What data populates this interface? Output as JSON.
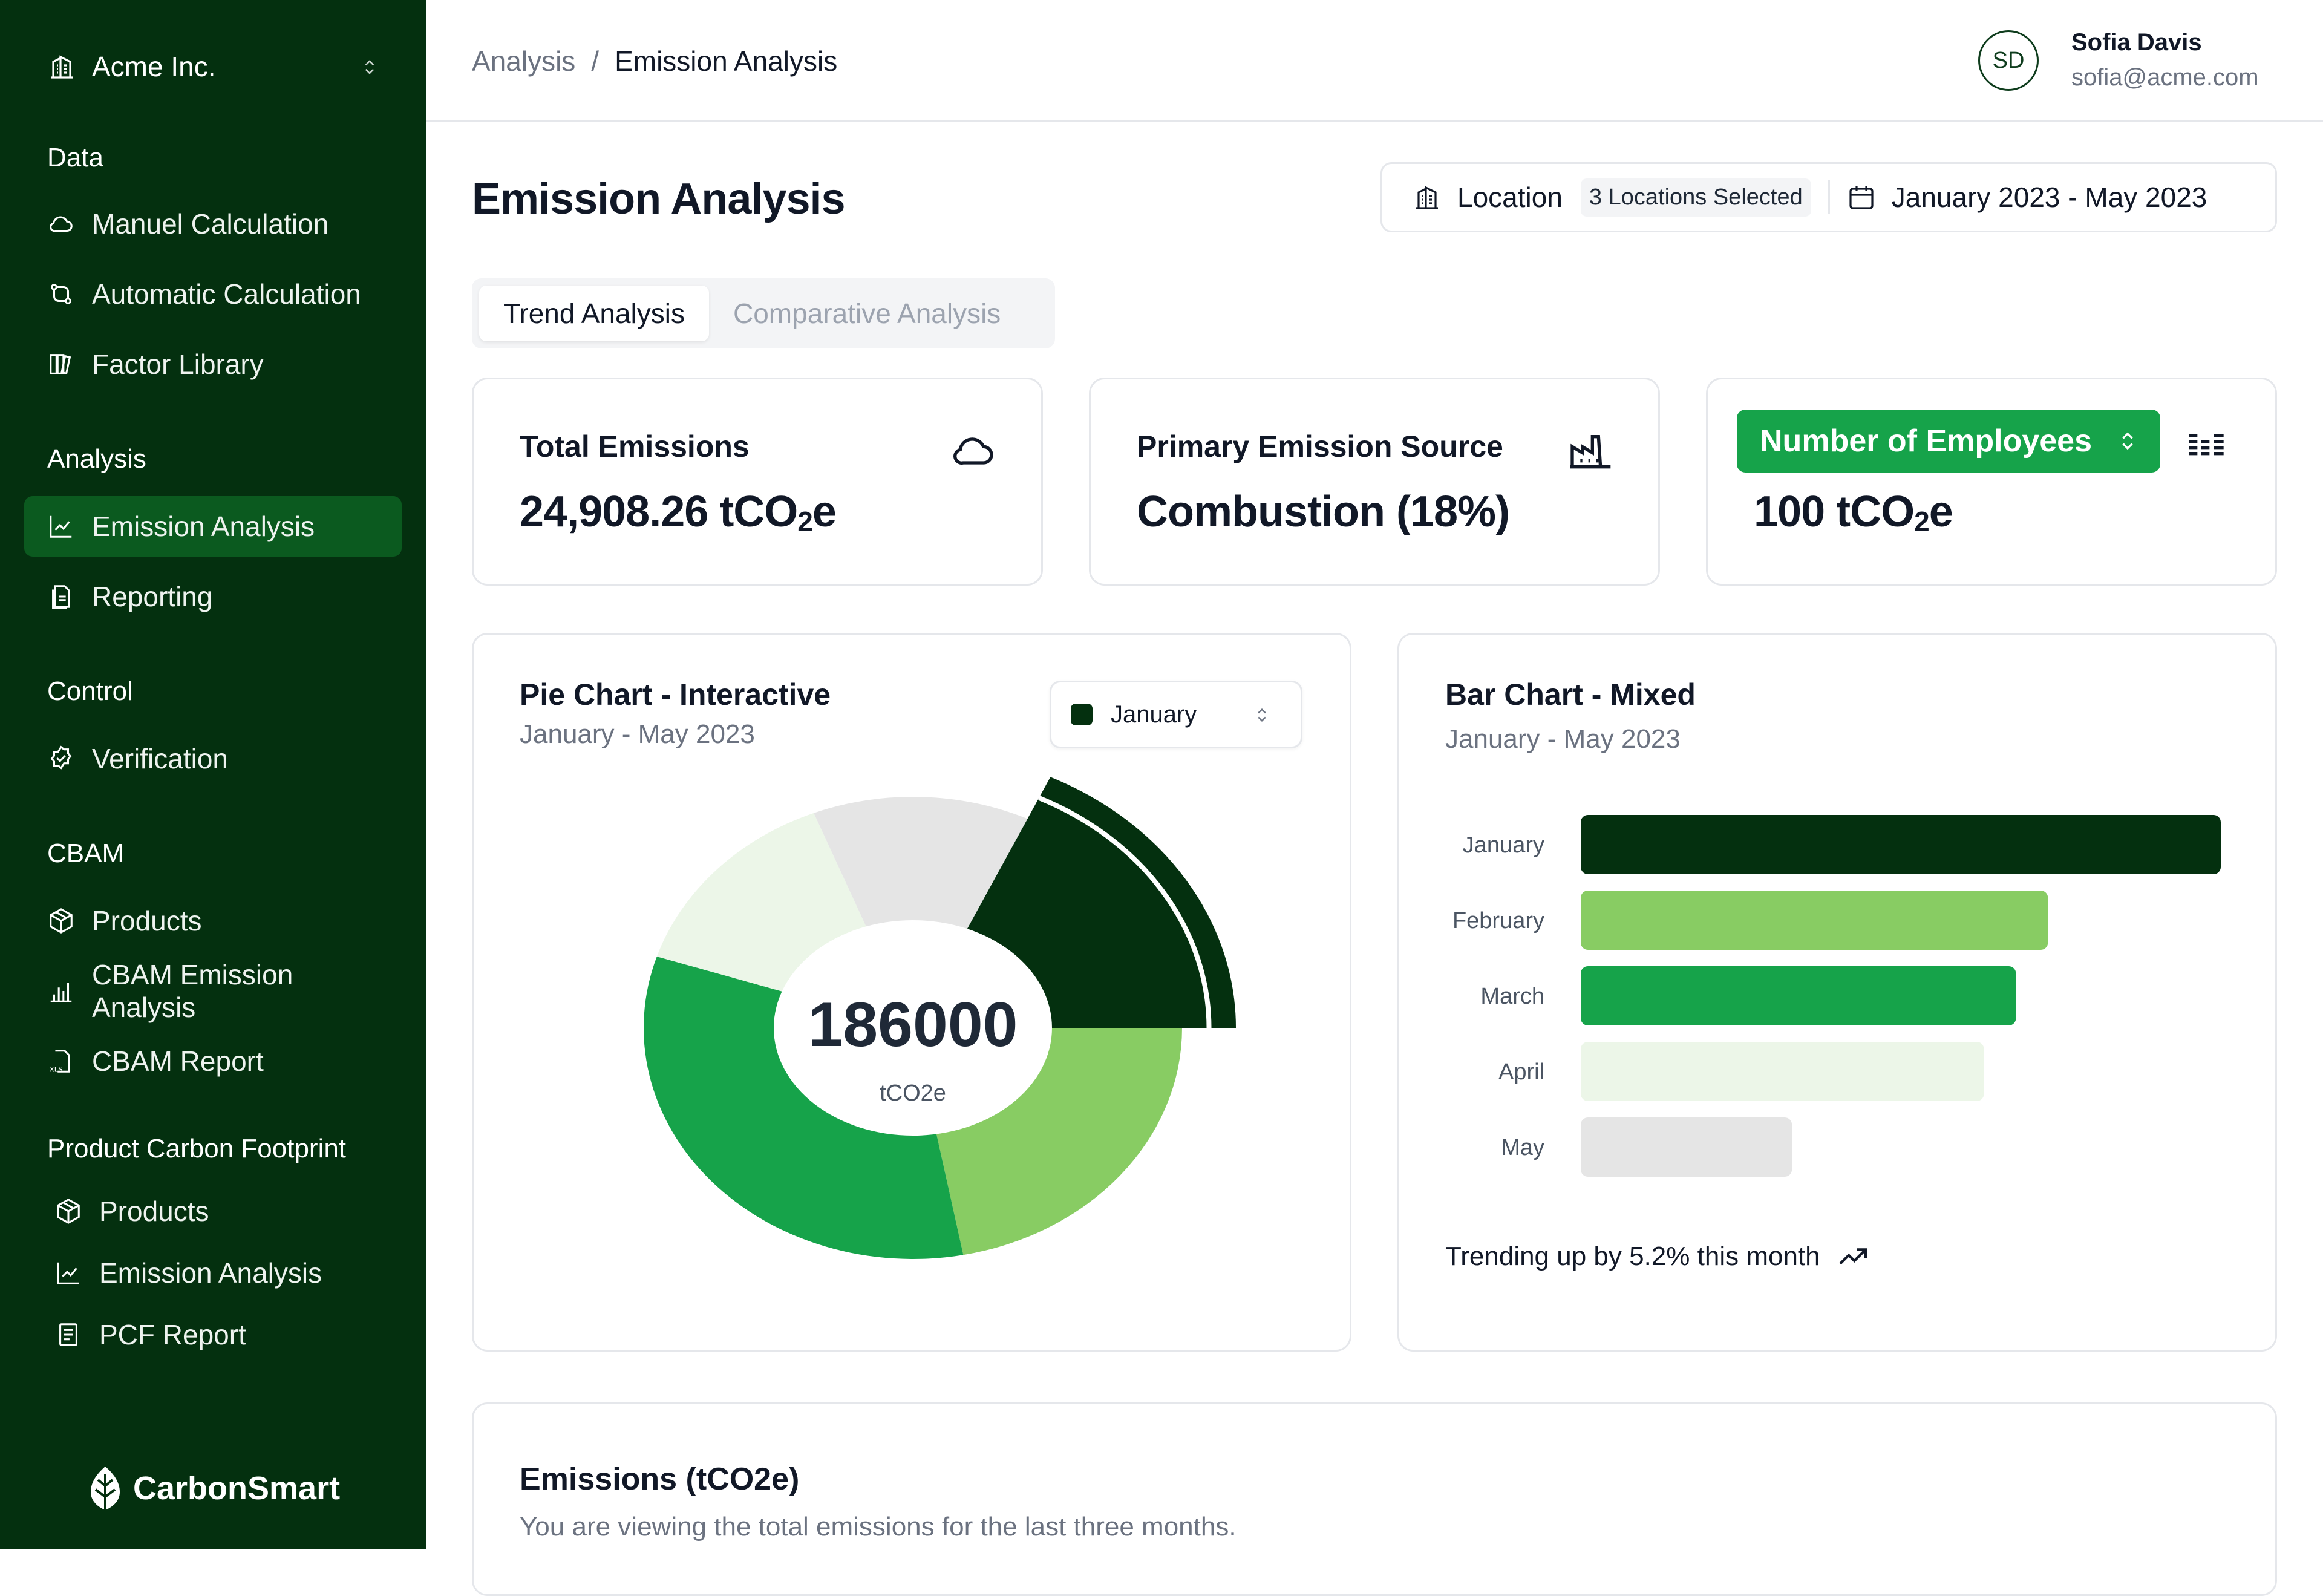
{
  "sidebar": {
    "org_name": "Acme Inc.",
    "sections": [
      {
        "title": "Data",
        "items": [
          {
            "label": "Manuel Calculation",
            "icon": "cloud-icon"
          },
          {
            "label": "Automatic Calculation",
            "icon": "route-icon"
          },
          {
            "label": "Factor Library",
            "icon": "library-icon"
          }
        ]
      },
      {
        "title": "Analysis",
        "items": [
          {
            "label": "Emission Analysis",
            "icon": "line-chart-icon",
            "active": true
          },
          {
            "label": "Reporting",
            "icon": "file-icon"
          }
        ]
      },
      {
        "title": "Control",
        "items": [
          {
            "label": "Verification",
            "icon": "badge-check-icon"
          }
        ]
      },
      {
        "title": "CBAM",
        "items": [
          {
            "label": "Products",
            "icon": "package-icon"
          },
          {
            "label": "CBAM Emission Analysis",
            "icon": "bar-chart-icon"
          },
          {
            "label": "CBAM Report",
            "icon": "xls-file-icon"
          }
        ]
      },
      {
        "title": "Product Carbon Footprint",
        "items": [
          {
            "label": "Products",
            "icon": "package-icon"
          },
          {
            "label": "Emission Analysis",
            "icon": "line-chart-icon"
          },
          {
            "label": "PCF Report",
            "icon": "report-icon"
          }
        ]
      }
    ],
    "brand": "CarbonSmart"
  },
  "header": {
    "breadcrumb": [
      "Analysis",
      "Emission Analysis"
    ],
    "separator": "/",
    "user": {
      "initials": "SD",
      "name": "Sofia Davis",
      "email": "sofia@acme.com"
    }
  },
  "main": {
    "title": "Emission Analysis",
    "filters": {
      "location_label": "Location",
      "location_badge": "3 Locations Selected",
      "date_range": "January 2023 - May 2023"
    },
    "tabs": [
      {
        "label": "Trend Analysis",
        "active": true
      },
      {
        "label": "Comparative Analysis",
        "active": false
      }
    ],
    "stats": [
      {
        "label": "Total Emissions",
        "value": "24,908.26 tCO",
        "sub": "2",
        "suffix": "e"
      },
      {
        "label": "Primary Emission Source",
        "value": "Combustion (18%)"
      },
      {
        "select_label": "Number of Employees",
        "value": "100 tCO",
        "sub": "2",
        "suffix": "e"
      }
    ],
    "pie_card": {
      "title": "Pie Chart - Interactive",
      "subtitle": "January - May 2023",
      "select_value": "January"
    },
    "bar_card": {
      "title": "Bar Chart - Mixed",
      "subtitle": "January - May 2023",
      "trend_text": "Trending up by 5.2% this month"
    },
    "table_card": {
      "title": "Emissions (tCO2e)",
      "subtitle": "You are viewing the total emissions for the last three months."
    }
  },
  "chart_data": [
    {
      "type": "pie",
      "title": "Pie Chart - Interactive",
      "subtitle": "January - May 2023",
      "center_value": "186000",
      "center_unit": "tCO2e",
      "active_slice": "January",
      "slices": [
        {
          "label": "January",
          "value": 0.18,
          "color": "#04300f"
        },
        {
          "label": "February",
          "value": 0.22,
          "color": "#88cc63"
        },
        {
          "label": "March",
          "value": 0.33,
          "color": "#16a34a"
        },
        {
          "label": "April",
          "value": 0.14,
          "color": "#ecf6e8"
        },
        {
          "label": "May",
          "value": 0.13,
          "color": "#e5e5e5"
        }
      ]
    },
    {
      "type": "bar",
      "orientation": "horizontal",
      "title": "Bar Chart - Mixed",
      "subtitle": "January - May 2023",
      "categories": [
        "January",
        "February",
        "March",
        "April",
        "May"
      ],
      "values": [
        100,
        73,
        68,
        63,
        33
      ],
      "colors": [
        "#04300f",
        "#88cc63",
        "#16a34a",
        "#ecf6e8",
        "#e5e5e5"
      ]
    }
  ]
}
